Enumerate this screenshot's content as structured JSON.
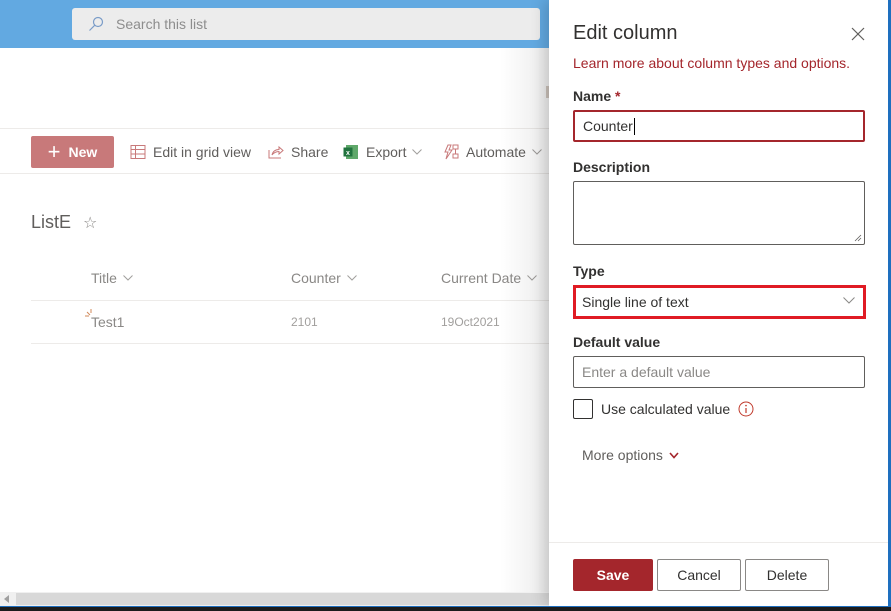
{
  "search": {
    "placeholder": "Search this list"
  },
  "commandbar": {
    "new_label": "New",
    "edit_grid_label": "Edit in grid view",
    "share_label": "Share",
    "export_label": "Export",
    "automate_label": "Automate"
  },
  "list": {
    "title": "ListE",
    "columns": [
      "Title",
      "Counter",
      "Current Date"
    ],
    "rows": [
      {
        "title": "Test1",
        "counter": "2101",
        "current_date": "19Oct2021"
      }
    ]
  },
  "panel": {
    "title": "Edit column",
    "learn_more": "Learn more about column types and options.",
    "name_label": "Name",
    "name_required": "*",
    "name_value": "Counter",
    "description_label": "Description",
    "description_value": "",
    "type_label": "Type",
    "type_value": "Single line of text",
    "default_label": "Default value",
    "default_placeholder": "Enter a default value",
    "use_calculated_label": "Use calculated value",
    "use_calculated_checked": false,
    "more_options_label": "More options",
    "save_label": "Save",
    "cancel_label": "Cancel",
    "delete_label": "Delete"
  },
  "colors": {
    "suitebar": "#62a9e1",
    "accent": "#a4262c",
    "highlight_border": "#e01b24",
    "new_button": "#c8797a"
  }
}
